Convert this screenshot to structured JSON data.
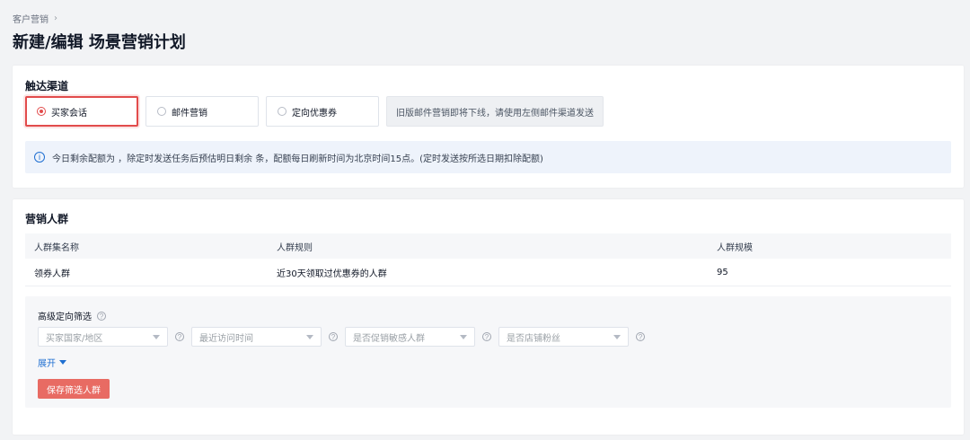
{
  "breadcrumb": {
    "item": "客户营销"
  },
  "page": {
    "title": "新建/编辑 场景营销计划"
  },
  "reach_channel": {
    "title": "触达渠道",
    "options": [
      {
        "label": "买家会话",
        "selected": true
      },
      {
        "label": "邮件营销",
        "selected": false
      },
      {
        "label": "定向优惠券",
        "selected": false
      }
    ],
    "legacy_notice": "旧版邮件营销即将下线，请使用左侧邮件渠道发送",
    "info_text": "今日剩余配额为 ，除定时发送任务后预估明日剩余 条，配额每日刷新时间为北京时间15点。(定时发送按所选日期扣除配额)"
  },
  "audience": {
    "title": "营销人群",
    "table": {
      "headers": [
        "人群集名称",
        "人群规则",
        "人群规模"
      ],
      "rows": [
        [
          "领券人群",
          "近30天领取过优惠券的人群",
          "95"
        ]
      ]
    },
    "advanced_filter": {
      "title": "高级定向筛选",
      "filters": [
        {
          "placeholder": "买家国家/地区"
        },
        {
          "placeholder": "最近访问时间"
        },
        {
          "placeholder": "是否促销敏感人群"
        },
        {
          "placeholder": "是否店铺粉丝"
        }
      ],
      "expand_label": "展开",
      "save_button_label": "保存筛选人群"
    }
  },
  "colors": {
    "selected_border": "#e24b4b",
    "primary_button": "#e86b63",
    "link_blue": "#1f6fd1",
    "info_bg": "#eef3fb"
  },
  "icons": {
    "info": "info-circle-icon",
    "help": "question-circle-icon",
    "chevron": "chevron-right-icon",
    "dropdown": "caret-down-icon"
  }
}
